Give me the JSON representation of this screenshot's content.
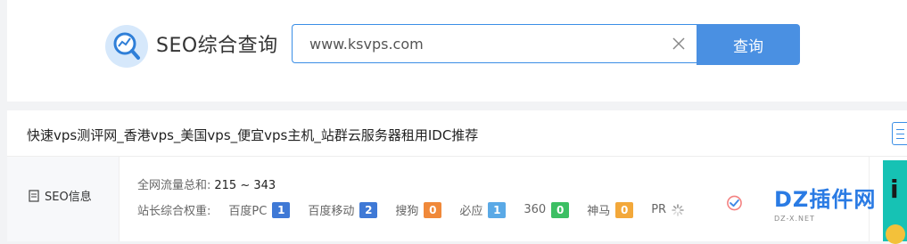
{
  "header": {
    "brand": "SEO综合查询",
    "search_value": "www.ksvps.com",
    "search_button": "查询"
  },
  "site": {
    "title": "快速vps测评网_香港vps_美国vps_便宜vps主机_站群云服务器租用IDC推荐"
  },
  "seo": {
    "section_label": "SEO信息",
    "traffic_label": "全网流量总和:",
    "traffic_value": "215 ~ 343",
    "weight_label": "站长综合权重:",
    "metrics": [
      {
        "label": "百度PC",
        "value": "1",
        "color": "#3f79d6"
      },
      {
        "label": "百度移动",
        "value": "2",
        "color": "#3f79d6"
      },
      {
        "label": "搜狗",
        "value": "0",
        "color": "#f0893a"
      },
      {
        "label": "必应",
        "value": "1",
        "color": "#5aa9e6"
      },
      {
        "label": "360",
        "value": "0",
        "color": "#3cbf63"
      },
      {
        "label": "神马",
        "value": "0",
        "color": "#f3a83a"
      },
      {
        "label": "PR",
        "value": "",
        "color": ""
      }
    ]
  },
  "watermark": {
    "text": "DZ插件网",
    "sub": "DZ-X.NET"
  },
  "icons": [
    "magnifier-chart-logo",
    "clear-icon",
    "document-icon",
    "loading-spinner-icon",
    "menu-icon"
  ]
}
